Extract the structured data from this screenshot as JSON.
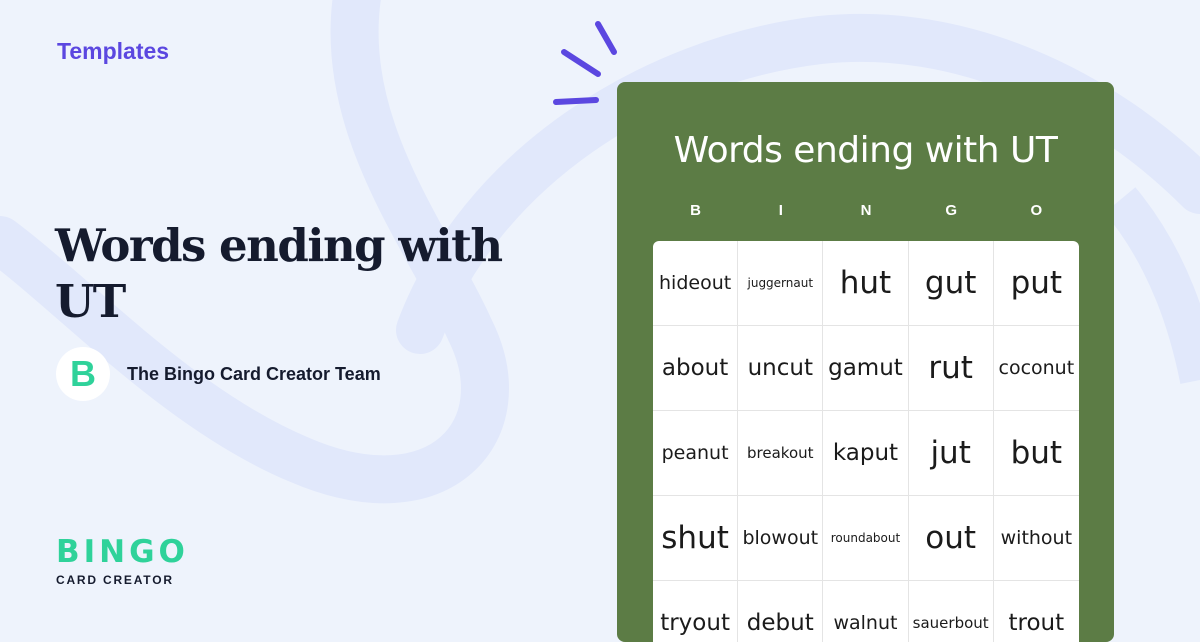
{
  "header": {
    "category": "Templates"
  },
  "article": {
    "title": "Words ending with UT",
    "author": {
      "initial": "B",
      "name": "The Bingo Card Creator Team"
    }
  },
  "brand": {
    "word": "BINGO",
    "sub": "CARD CREATOR"
  },
  "card": {
    "title": "Words ending with UT",
    "letters": [
      "B",
      "I",
      "N",
      "G",
      "O"
    ],
    "rows": [
      [
        {
          "word": "hideout",
          "size": "md"
        },
        {
          "word": "juggernaut",
          "size": "xs"
        },
        {
          "word": "hut",
          "size": "xl"
        },
        {
          "word": "gut",
          "size": "xl"
        },
        {
          "word": "put",
          "size": "xl"
        }
      ],
      [
        {
          "word": "about",
          "size": "lg"
        },
        {
          "word": "uncut",
          "size": "lg"
        },
        {
          "word": "gamut",
          "size": "lg"
        },
        {
          "word": "rut",
          "size": "xl"
        },
        {
          "word": "coconut",
          "size": "md"
        }
      ],
      [
        {
          "word": "peanut",
          "size": "md"
        },
        {
          "word": "breakout",
          "size": "sm"
        },
        {
          "word": "kaput",
          "size": "lg"
        },
        {
          "word": "jut",
          "size": "xl"
        },
        {
          "word": "but",
          "size": "xl"
        }
      ],
      [
        {
          "word": "shut",
          "size": "xl"
        },
        {
          "word": "blowout",
          "size": "md"
        },
        {
          "word": "roundabout",
          "size": "xs"
        },
        {
          "word": "out",
          "size": "xl"
        },
        {
          "word": "without",
          "size": "md"
        }
      ],
      [
        {
          "word": "tryout",
          "size": "lg"
        },
        {
          "word": "debut",
          "size": "lg"
        },
        {
          "word": "walnut",
          "size": "md"
        },
        {
          "word": "sauerbout",
          "size": "sm"
        },
        {
          "word": "trout",
          "size": "lg"
        }
      ]
    ]
  },
  "colors": {
    "background": "#eef3fc",
    "accent": "#5b47e0",
    "brand_green": "#2fd29a",
    "card_green": "#5c7c45",
    "text_dark": "#151b2e"
  },
  "icons": [
    "spark-lines-icon",
    "background-swirl"
  ]
}
